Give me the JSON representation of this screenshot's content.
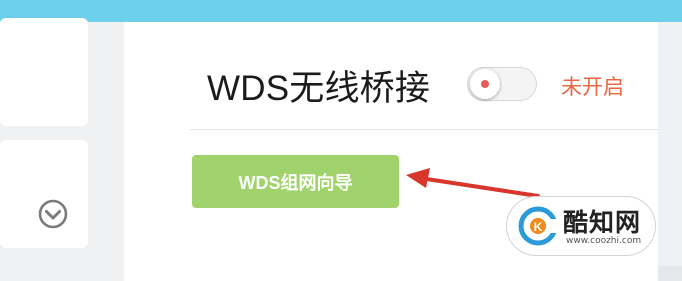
{
  "settings": {
    "title": "WDS无线桥接",
    "status_text": "未开启",
    "toggle_state": "off",
    "wizard_button_label": "WDS组网向导"
  },
  "watermark": {
    "brand": "酷知网",
    "url": "www.coozhi.com"
  },
  "colors": {
    "top_bar": "#6dd1ee",
    "button": "#a0d36c",
    "status": "#e6683f",
    "arrow": "#d9362b"
  },
  "icons": {
    "chevron": "chevron-down-circle-icon",
    "arrow": "red-annotation-arrow",
    "logo": "coozhi-logo-icon"
  }
}
